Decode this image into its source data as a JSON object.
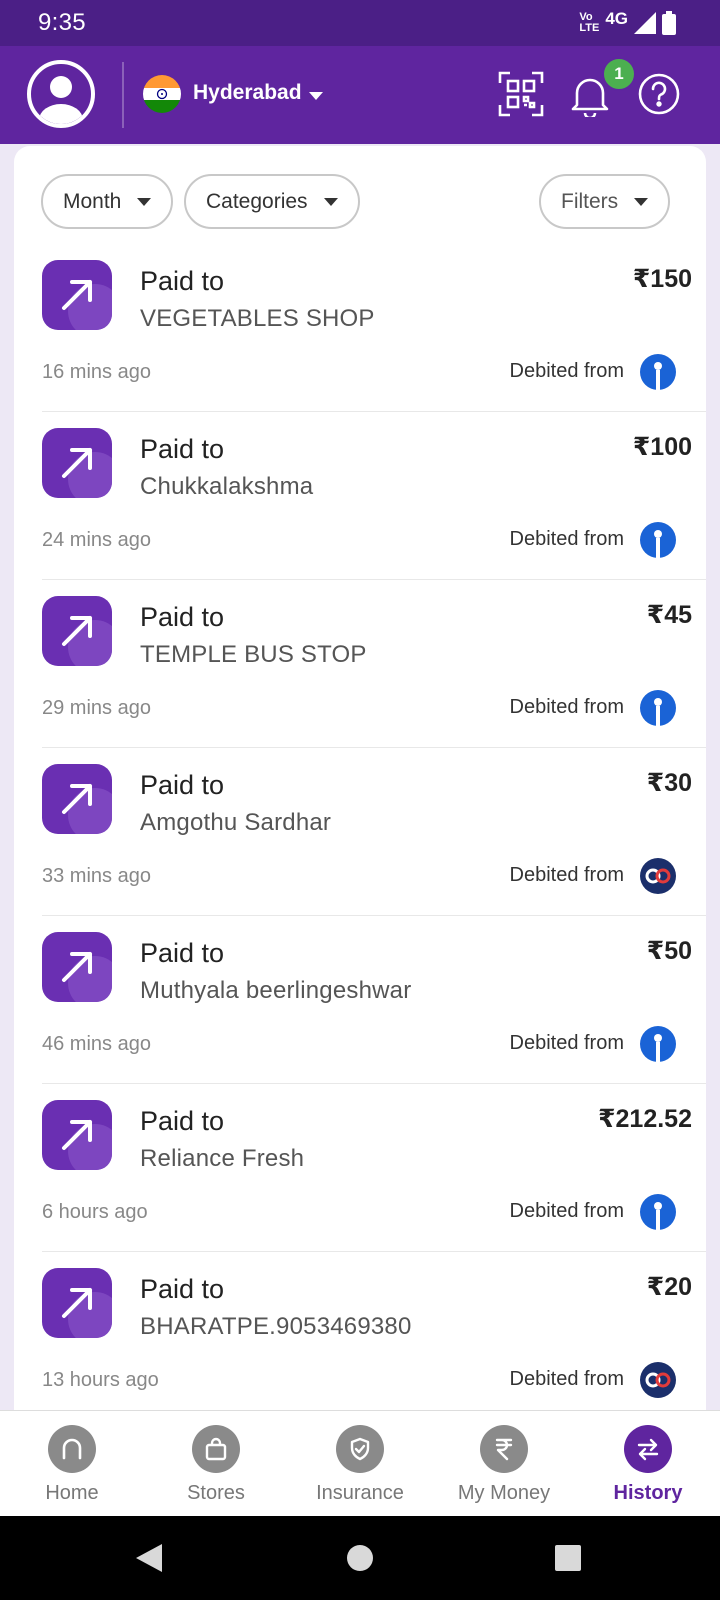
{
  "status_bar": {
    "time": "9:35",
    "volte_line1": "Vo",
    "volte_line2": "LTE",
    "network": "4G"
  },
  "header": {
    "city": "Hyderabad",
    "notification_count": "1"
  },
  "filters": {
    "month": "Month",
    "categories": "Categories",
    "filters": "Filters"
  },
  "transactions": [
    {
      "title": "Paid to",
      "name": "VEGETABLES SHOP",
      "amount": "₹150",
      "time": "16 mins ago",
      "debited_label": "Debited from",
      "bank": "sbi"
    },
    {
      "title": "Paid to",
      "name": "Chukkalakshma",
      "amount": "₹100",
      "time": "24 mins ago",
      "debited_label": "Debited from",
      "bank": "sbi"
    },
    {
      "title": "Paid to",
      "name": "TEMPLE BUS STOP",
      "amount": "₹45",
      "time": "29 mins ago",
      "debited_label": "Debited from",
      "bank": "sbi"
    },
    {
      "title": "Paid to",
      "name": "Amgothu Sardhar",
      "amount": "₹30",
      "time": "33 mins ago",
      "debited_label": "Debited from",
      "bank": "kotak"
    },
    {
      "title": "Paid to",
      "name": "Muthyala beerlingeshwar",
      "amount": "₹50",
      "time": "46 mins ago",
      "debited_label": "Debited from",
      "bank": "sbi"
    },
    {
      "title": "Paid to",
      "name": "Reliance Fresh",
      "amount": "₹212.52",
      "time": "6 hours ago",
      "debited_label": "Debited from",
      "bank": "sbi"
    },
    {
      "title": "Paid to",
      "name": "BHARATPE.9053469380",
      "amount": "₹20",
      "time": "13 hours ago",
      "debited_label": "Debited from",
      "bank": "kotak"
    }
  ],
  "bottom_nav": [
    {
      "label": "Home",
      "icon": "home-icon",
      "active": false
    },
    {
      "label": "Stores",
      "icon": "shopping-bag-icon",
      "active": false
    },
    {
      "label": "Insurance",
      "icon": "shield-check-icon",
      "active": false
    },
    {
      "label": "My Money",
      "icon": "rupee-icon",
      "active": false
    },
    {
      "label": "History",
      "icon": "transfer-arrows-icon",
      "active": true
    }
  ],
  "colors": {
    "brand": "#5f259f",
    "status_bar": "#4b1f86",
    "badge": "#4caf50",
    "sbi": "#1a63d6",
    "kotak": "#1b2f6b"
  }
}
